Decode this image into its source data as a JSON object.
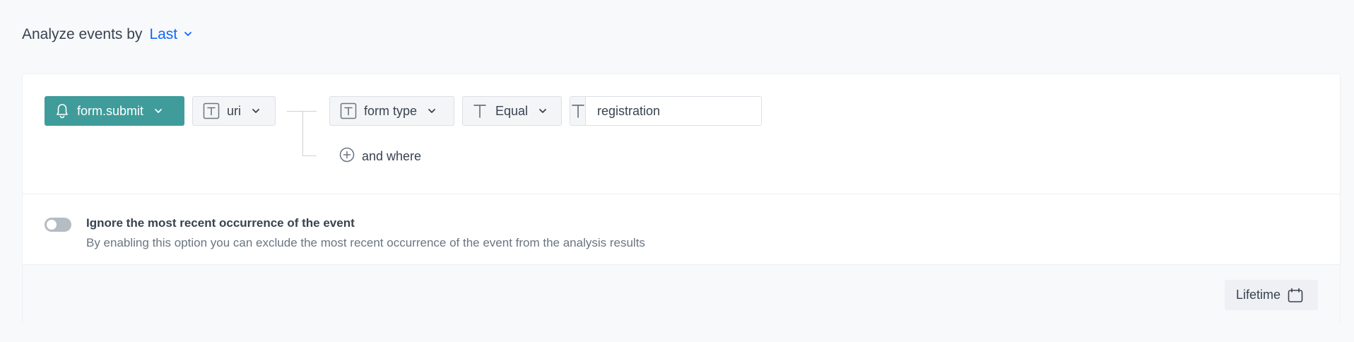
{
  "header": {
    "title": "Analyze events by",
    "mode_value": "Last",
    "accent_color": "#0b68ff"
  },
  "filter": {
    "event": {
      "label": "form.submit",
      "icon": "bell-icon",
      "color": "#3f9c9a"
    },
    "parameter": {
      "label": "uri",
      "icon": "text-type-icon"
    },
    "condition": {
      "attribute": {
        "label": "form type",
        "icon": "text-type-icon"
      },
      "operator": {
        "label": "Equal",
        "icon": "text-icon"
      },
      "value": {
        "value": "registration",
        "icon": "text-icon"
      }
    },
    "and_where_label": "and where"
  },
  "ignore_option": {
    "enabled": false,
    "title": "Ignore the most recent occurrence of the event",
    "description": "By enabling this option you can exclude the most recent occurrence of the event from the analysis results"
  },
  "footer": {
    "date_range_label": "Lifetime",
    "date_range_icon": "calendar-icon"
  }
}
